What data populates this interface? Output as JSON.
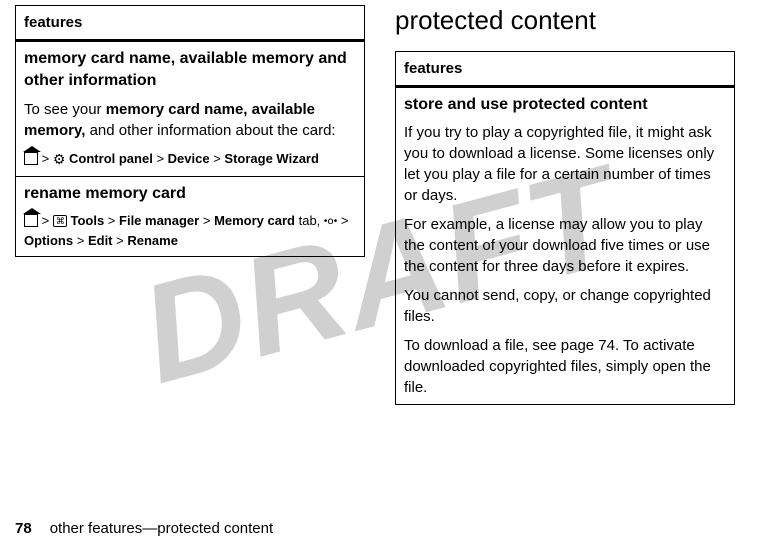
{
  "watermark": "DRAFT",
  "left_table": {
    "header": "features",
    "row1": {
      "title": "memory card name, available memory and other information",
      "body_prefix": "To see your ",
      "body_bold": "memory card name, available memory,",
      "body_suffix": " and other information about the card:",
      "path_parts": {
        "cp": "Control panel",
        "dev": "Device",
        "sw": "Storage Wizard"
      }
    },
    "row2": {
      "title": "rename memory card",
      "path_parts": {
        "tools": "Tools",
        "fm": "File manager",
        "mc": "Memory card",
        "tab": " tab, ",
        "options": "Options",
        "edit": "Edit",
        "rename": "Rename"
      }
    }
  },
  "right_section": {
    "title": "protected content",
    "header": "features",
    "row": {
      "title": "store and use protected content",
      "p1": "If you try to play a copyrighted file, it might ask you to download a license. Some licenses only let you play a file for a certain number of times or days.",
      "p2": "For example, a license may allow you to play the content of your download five times or use the content for three days before it expires.",
      "p3": "You cannot send, copy, or change copyrighted files.",
      "p4": "To download a file, see page 74. To activate downloaded copyrighted files, simply open the file."
    }
  },
  "footer": {
    "page": "78",
    "text": "other features—protected content"
  },
  "gt": ">"
}
